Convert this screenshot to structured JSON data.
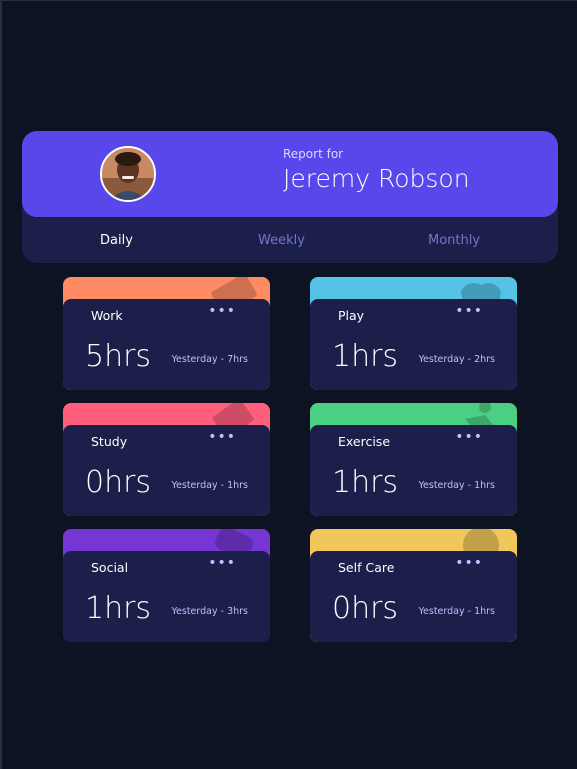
{
  "profile": {
    "report_label": "Report for",
    "name": "Jeremy Robson",
    "avatar_alt": "avatar"
  },
  "tabs": [
    {
      "label": "Daily",
      "active": true
    },
    {
      "label": "Weekly",
      "active": false
    },
    {
      "label": "Monthly",
      "active": false
    }
  ],
  "activities": [
    {
      "title": "Work",
      "hours": "5hrs",
      "previous": "Yesterday - 7hrs",
      "color": "#ff8b64",
      "icon": "briefcase-icon"
    },
    {
      "title": "Play",
      "hours": "1hrs",
      "previous": "Yesterday - 2hrs",
      "color": "#55c2e6",
      "icon": "gamepad-icon"
    },
    {
      "title": "Study",
      "hours": "0hrs",
      "previous": "Yesterday - 1hrs",
      "color": "#ff5e7d",
      "icon": "book-icon"
    },
    {
      "title": "Exercise",
      "hours": "1hrs",
      "previous": "Yesterday - 1hrs",
      "color": "#4bcf82",
      "icon": "runner-icon"
    },
    {
      "title": "Social",
      "hours": "1hrs",
      "previous": "Yesterday - 3hrs",
      "color": "#7536d3",
      "icon": "chat-icon"
    },
    {
      "title": "Self Care",
      "hours": "0hrs",
      "previous": "Yesterday - 1hrs",
      "color": "#f1c65b",
      "icon": "selfcare-icon"
    }
  ],
  "menu_dots": "•••"
}
